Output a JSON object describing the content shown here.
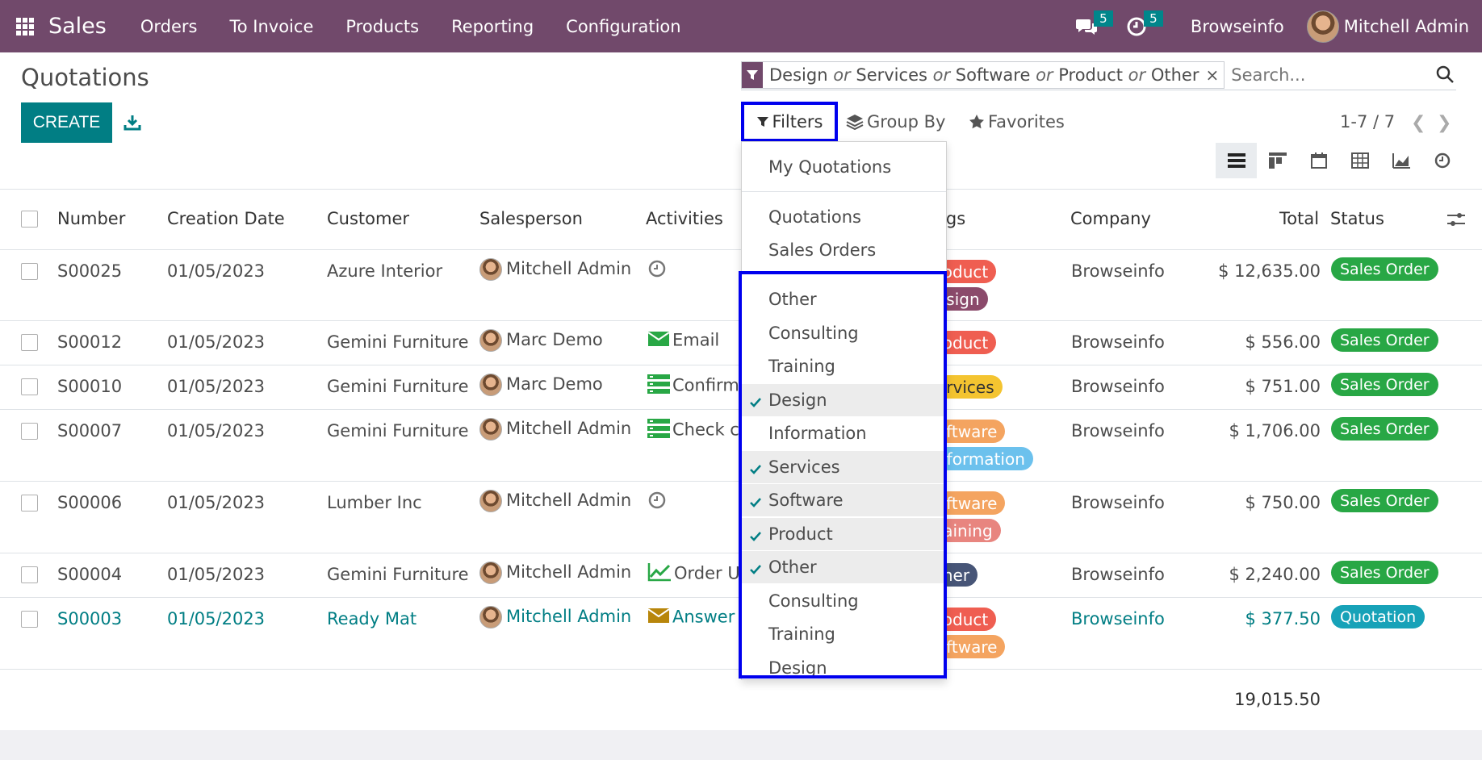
{
  "navbar": {
    "brand": "Sales",
    "menu": [
      "Orders",
      "To Invoice",
      "Products",
      "Reporting",
      "Configuration"
    ],
    "messages_count": "5",
    "activities_count": "5",
    "company": "Browseinfo",
    "user": "Mitchell Admin"
  },
  "control_panel": {
    "title": "Quotations",
    "create_label": "CREATE",
    "search": {
      "facet_values": [
        "Design",
        "Services",
        "Software",
        "Product",
        "Other"
      ],
      "facet_separator": "or",
      "facet_close": "×",
      "placeholder": "Search..."
    },
    "filters_label": "Filters",
    "groupby_label": "Group By",
    "favorites_label": "Favorites",
    "pager": "1-7 / 7"
  },
  "table": {
    "columns": [
      "Number",
      "Creation Date",
      "Customer",
      "Salesperson",
      "Activities",
      "Tags",
      "Company",
      "Total",
      "Status"
    ],
    "tags_header_visible": "ags",
    "rows": [
      {
        "number": "S00025",
        "date": "01/05/2023",
        "customer": "Azure Interior",
        "salesperson": "Mitchell Admin",
        "activity": "",
        "activity_icon": "clock-icon",
        "tags": [
          {
            "text": "roduct",
            "color": "#ef5e51"
          },
          {
            "text": "esign",
            "color": "#8b4a6b"
          }
        ],
        "company": "Browseinfo",
        "total": "$ 12,635.00",
        "status": "Sales Order",
        "status_color": "#28a745"
      },
      {
        "number": "S00012",
        "date": "01/05/2023",
        "customer": "Gemini Furniture",
        "salesperson": "Marc Demo",
        "activity": "Email",
        "activity_icon": "envelope-icon",
        "tags": [
          {
            "text": "roduct",
            "color": "#ef5e51"
          }
        ],
        "company": "Browseinfo",
        "total": "$ 556.00",
        "status": "Sales Order",
        "status_color": "#28a745"
      },
      {
        "number": "S00010",
        "date": "01/05/2023",
        "customer": "Gemini Furniture",
        "salesperson": "Marc Demo",
        "activity": "Confirm",
        "activity_icon": "tasks-icon",
        "tags": [
          {
            "text": "ervices",
            "color": "#f4c430",
            "text_color": "#333"
          }
        ],
        "company": "Browseinfo",
        "total": "$ 751.00",
        "status": "Sales Order",
        "status_color": "#28a745"
      },
      {
        "number": "S00007",
        "date": "01/05/2023",
        "customer": "Gemini Furniture",
        "salesperson": "Mitchell Admin",
        "activity": "Check c",
        "activity_icon": "tasks-icon",
        "tags": [
          {
            "text": "oftware",
            "color": "#f4a460"
          },
          {
            "text": "nformation",
            "color": "#6cc1ed"
          }
        ],
        "company": "Browseinfo",
        "total": "$ 1,706.00",
        "status": "Sales Order",
        "status_color": "#28a745"
      },
      {
        "number": "S00006",
        "date": "01/05/2023",
        "customer": "Lumber Inc",
        "salesperson": "Mitchell Admin",
        "activity": "",
        "activity_icon": "clock-icon",
        "tags": [
          {
            "text": "oftware",
            "color": "#f4a460"
          },
          {
            "text": "raining",
            "color": "#e8857f"
          }
        ],
        "company": "Browseinfo",
        "total": "$ 750.00",
        "status": "Sales Order",
        "status_color": "#28a745"
      },
      {
        "number": "S00004",
        "date": "01/05/2023",
        "customer": "Gemini Furniture",
        "salesperson": "Mitchell Admin",
        "activity": "Order U",
        "activity_icon": "chart-icon",
        "tags": [
          {
            "text": "ther",
            "color": "#475577"
          }
        ],
        "company": "Browseinfo",
        "total": "$ 2,240.00",
        "status": "Sales Order",
        "status_color": "#28a745"
      },
      {
        "number": "S00003",
        "date": "01/05/2023",
        "customer": "Ready Mat",
        "salesperson": "Mitchell Admin",
        "activity": "Answer",
        "activity_icon": "envelope-icon",
        "tags": [
          {
            "text": "roduct",
            "color": "#ef5e51"
          },
          {
            "text": "oftware",
            "color": "#f4a460"
          }
        ],
        "company": "Browseinfo",
        "total": "$ 377.50",
        "status": "Quotation",
        "status_color": "#17a2b8"
      }
    ],
    "sum_total": "19,015.50"
  },
  "filters_dropdown": {
    "group1": [
      "My Quotations"
    ],
    "group2": [
      "Quotations",
      "Sales Orders"
    ],
    "tag_filters": [
      {
        "label": "Other",
        "checked": false
      },
      {
        "label": "Consulting",
        "checked": false
      },
      {
        "label": "Training",
        "checked": false
      },
      {
        "label": "Design",
        "checked": true
      },
      {
        "label": "Information",
        "checked": false
      },
      {
        "label": "Services",
        "checked": true
      },
      {
        "label": "Software",
        "checked": true
      },
      {
        "label": "Product",
        "checked": true
      },
      {
        "label": "Other",
        "checked": true
      },
      {
        "label": "Consulting",
        "checked": false
      },
      {
        "label": "Training",
        "checked": false
      },
      {
        "label": "Design",
        "checked": false
      }
    ]
  },
  "colors": {
    "navbar": "#71496b",
    "primary": "#017e84",
    "highlight_border": "#0000ee",
    "activity_green": "#28a745",
    "activity_gold": "#b8860b"
  }
}
